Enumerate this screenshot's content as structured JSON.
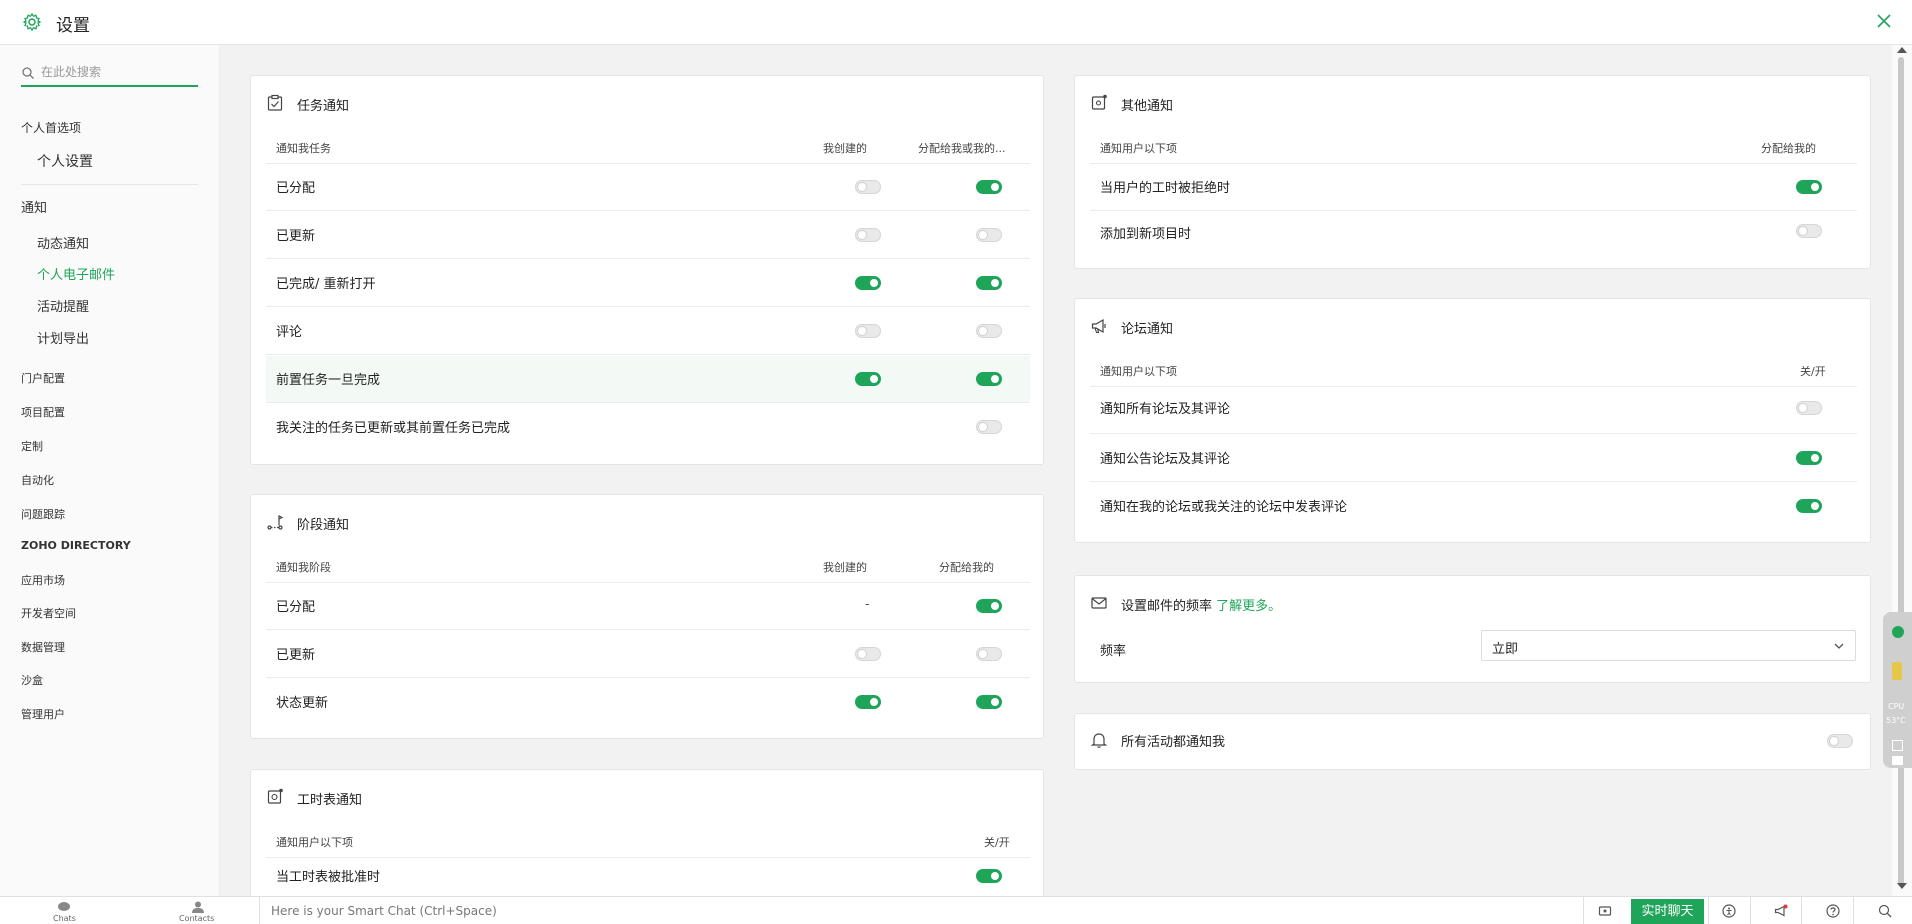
{
  "header": {
    "title": "设置"
  },
  "sidebar": {
    "search_placeholder": "在此处搜索",
    "section1": "个人首选项",
    "item_personal": "个人设置",
    "section2": "通知",
    "sub_items": [
      "动态通知",
      "个人电子邮件",
      "活动提醒",
      "计划导出"
    ],
    "active_sub": "个人电子邮件",
    "items": [
      "门户配置",
      "项目配置",
      "定制",
      "自动化",
      "问题跟踪",
      "ZOHO DIRECTORY",
      "应用市场",
      "开发者空间",
      "数据管理",
      "沙盒",
      "管理用户"
    ]
  },
  "task_card": {
    "title": "任务通知",
    "col_label": "通知我任务",
    "col_created": "我创建的",
    "col_assigned": "分配给我或我的...",
    "rows": [
      {
        "label": "已分配",
        "created": false,
        "assigned": true
      },
      {
        "label": "已更新",
        "created": false,
        "assigned": false
      },
      {
        "label": "已完成/ 重新打开",
        "created": true,
        "assigned": true
      },
      {
        "label": "评论",
        "created": false,
        "assigned": false
      },
      {
        "label": "前置任务一旦完成",
        "created": true,
        "assigned": true
      },
      {
        "label": "我关注的任务已更新或其前置任务已完成",
        "created": null,
        "assigned": false
      }
    ]
  },
  "phase_card": {
    "title": "阶段通知",
    "col_label": "通知我阶段",
    "col_created": "我创建的",
    "col_assigned": "分配给我的",
    "rows": [
      {
        "label": "已分配",
        "created": "-",
        "assigned": true
      },
      {
        "label": "已更新",
        "created": false,
        "assigned": false
      },
      {
        "label": "状态更新",
        "created": true,
        "assigned": true
      }
    ]
  },
  "timesheet_card": {
    "title": "工时表通知",
    "col_label": "通知用户以下项",
    "col_toggle": "关/开",
    "rows": [
      {
        "label": "当工时表被批准时",
        "value": true
      }
    ]
  },
  "other_card": {
    "title": "其他通知",
    "col_label": "通知用户以下项",
    "col_assigned": "分配给我的",
    "rows": [
      {
        "label": "当用户的工时被拒绝时",
        "value": true
      },
      {
        "label": "添加到新项目时",
        "value": false
      }
    ]
  },
  "forum_card": {
    "title": "论坛通知",
    "col_label": "通知用户以下项",
    "col_toggle": "关/开",
    "rows": [
      {
        "label": "通知所有论坛及其评论",
        "value": false
      },
      {
        "label": "通知公告论坛及其评论",
        "value": true
      },
      {
        "label": "通知在我的论坛或我关注的论坛中发表评论",
        "value": true
      }
    ]
  },
  "frequency_card": {
    "title": "设置邮件的频率",
    "link": "了解更多。",
    "label": "频率",
    "value": "立即"
  },
  "all_activity_card": {
    "title": "所有活动都通知我",
    "value": false
  },
  "widget": {
    "cpu": "CPU",
    "temp": "53°C"
  },
  "bottom_bar": {
    "chats": "Chats",
    "contacts": "Contacts",
    "smart_chat_placeholder": "Here is your Smart Chat (Ctrl+Space)",
    "live_chat": "实时聊天"
  },
  "colors": {
    "accent": "#1fa55a",
    "toggle_off": "#e9e9e9"
  }
}
